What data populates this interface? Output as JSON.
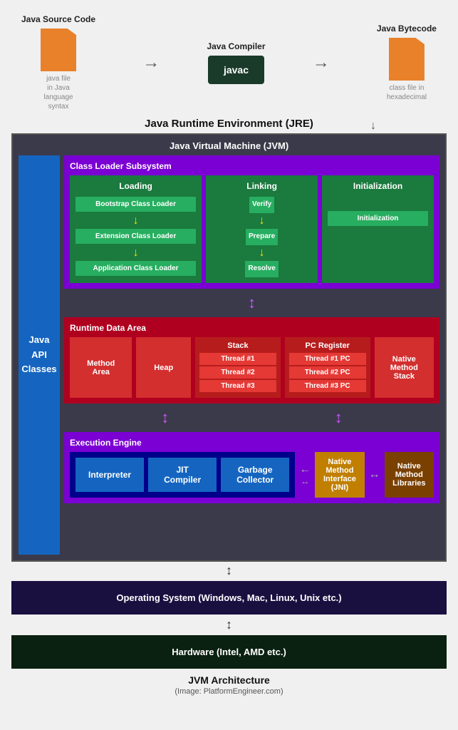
{
  "top": {
    "source_title": "Java Source Code",
    "source_sublabel": "java file\nin Java\nlanguage\nsyntax",
    "compiler_title": "Java Compiler",
    "compiler_button": "javac",
    "bytecode_title": "Java Bytecode",
    "bytecode_sublabel": "class file in\nhexadecimal"
  },
  "jre_label": "Java Runtime Environment (JRE)",
  "jvm": {
    "title": "Java Virtual Machine (JVM)",
    "sidebar_label": "Java\nAPI\nClasses",
    "class_loader": {
      "title": "Class Loader Subsystem",
      "loading": {
        "title": "Loading",
        "items": [
          "Bootstrap Class Loader",
          "Extension Class Loader",
          "Application Class Loader"
        ]
      },
      "linking": {
        "title": "Linking",
        "items": [
          "Verify",
          "Prepare",
          "Resolve"
        ]
      },
      "initialization": {
        "title": "Initialization",
        "item": "Initialization"
      }
    },
    "runtime_data": {
      "title": "Runtime Data Area",
      "method_area": "Method\nArea",
      "heap": "Heap",
      "stack": {
        "title": "Stack",
        "threads": [
          "Thread #1",
          "Thread #2",
          "Thread #3"
        ]
      },
      "pc_register": {
        "title": "PC Register",
        "threads": [
          "Thread #1 PC",
          "Thread #2 PC",
          "Thread #3 PC"
        ]
      },
      "native_method_stack": "Native\nMethod\nStack"
    },
    "execution_engine": {
      "title": "Execution Engine",
      "interpreter": "Interpreter",
      "jit_compiler": "JIT\nCompiler",
      "garbage_collector": "Garbage\nCollector",
      "native_method_interface": "Native\nMethod\nInterface\n(JNI)",
      "native_method_libraries": "Native\nMethod\nLibraries"
    }
  },
  "os_label": "Operating System (Windows, Mac, Linux, Unix etc.)",
  "hardware_label": "Hardware (Intel, AMD etc.)",
  "caption": "JVM Architecture",
  "caption_sub": "(Image: PlatformEngineer.com)"
}
